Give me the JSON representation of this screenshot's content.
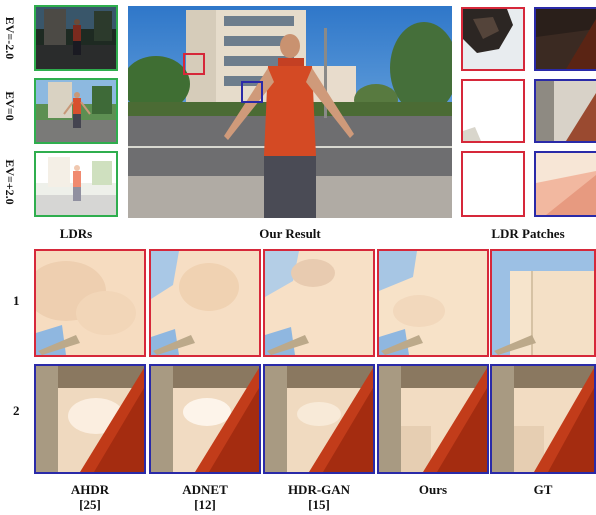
{
  "ev_labels": [
    "EV=-2.0",
    "EV=0",
    "EV=+2.0"
  ],
  "captions": {
    "ldrs": "LDRs",
    "our_result": "Our Result",
    "ldr_patches": "LDR Patches"
  },
  "rows": [
    "1",
    "2"
  ],
  "methods": [
    {
      "name": "AHDR",
      "ref": "[25]"
    },
    {
      "name": "ADNET",
      "ref": "[12]"
    },
    {
      "name": "HDR-GAN",
      "ref": "[15]"
    },
    {
      "name": "Ours",
      "ref": ""
    },
    {
      "name": "GT",
      "ref": ""
    }
  ],
  "colors": {
    "ldr_frame": "#2fae4e",
    "patch_red": "#d6283a",
    "patch_blue": "#2a2aa8"
  }
}
